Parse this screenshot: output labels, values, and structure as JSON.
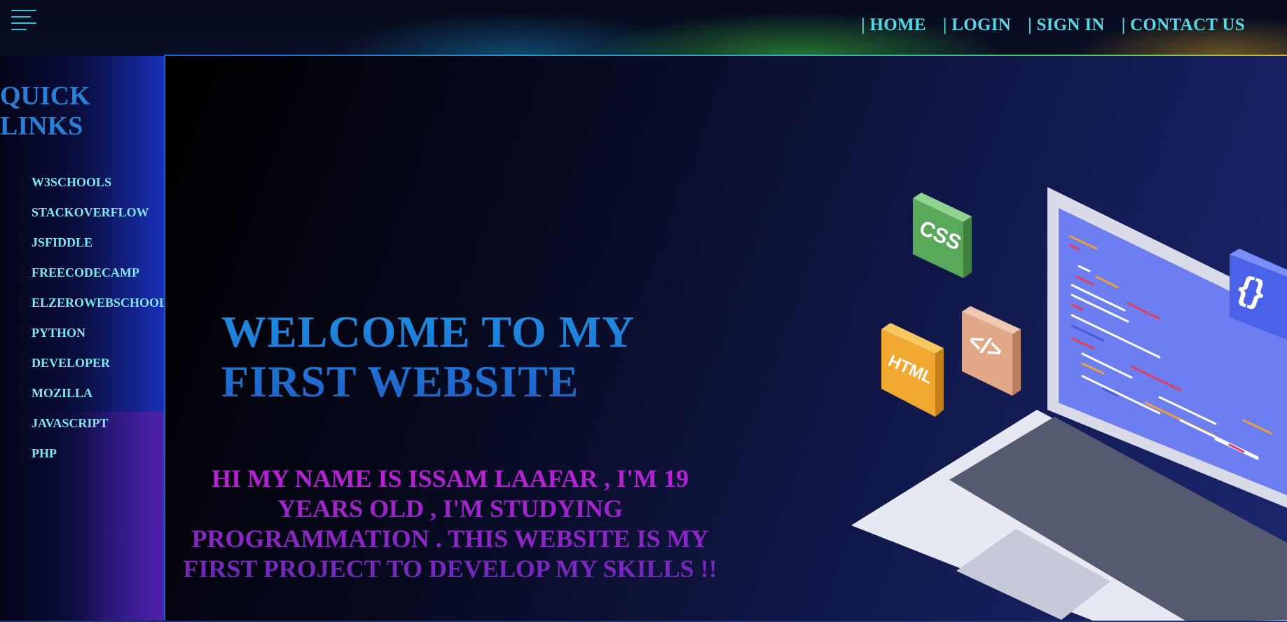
{
  "header": {
    "menu_icon": "hamburger-icon",
    "nav": [
      {
        "label": "| HOME"
      },
      {
        "label": "| LOGIN"
      },
      {
        "label": "| SIGN IN"
      },
      {
        "label": "| CONTACT US"
      }
    ]
  },
  "sidebar": {
    "title_line1": "QUICK",
    "title_line2": "LINKS",
    "links": [
      {
        "label": "W3SCHOOLS"
      },
      {
        "label": "STACKOVERFLOW"
      },
      {
        "label": "JSFIDDLE"
      },
      {
        "label": "FREECODECAMP"
      },
      {
        "label": "ELZEROWEBSCHOOL"
      },
      {
        "label": "PYTHON"
      },
      {
        "label": "DEVELOPER"
      },
      {
        "label": "MOZILLA"
      },
      {
        "label": "JAVASCRIPT"
      },
      {
        "label": "PHP"
      }
    ]
  },
  "hero": {
    "title_line1": "WELCOME TO MY",
    "title_line2": "FIRST WEBSITE",
    "intro": "HI MY NAME IS ISSAM LAAFAR , I'M 19 YEARS OLD , I'M STUDYING PROGRAMMATION . THIS WEBSITE IS MY FIRST PROJECT TO DEVELOP MY SKILLS !!",
    "illustration": {
      "badges": [
        "CSS",
        "</>",
        "HTML",
        "{}"
      ]
    }
  },
  "colors": {
    "nav_text": "#58d7e6",
    "link_text": "#7fe6ee",
    "title": "#1f8fe0",
    "intro": "#c020d8"
  }
}
